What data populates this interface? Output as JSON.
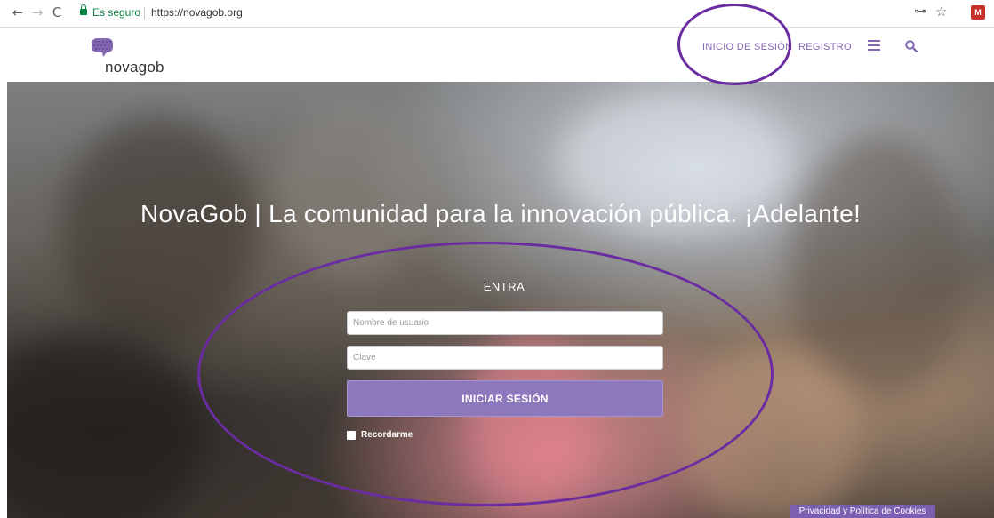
{
  "browser": {
    "back_glyph": "←",
    "forward_glyph": "→",
    "reload_glyph": "C",
    "secure_label": "Es seguro",
    "url": "https://novagob.org",
    "key_glyph": "⊶",
    "star_glyph": "☆",
    "extension_glyph": "M",
    "icons": [
      "back-icon",
      "forward-icon",
      "reload-icon",
      "lock-icon",
      "key-icon",
      "star-icon",
      "extension-icon"
    ]
  },
  "header": {
    "logo_text": "novagob",
    "nav": {
      "login": "INICIO DE SESIÓN",
      "register": "REGISTRO"
    },
    "icons": [
      "menu-icon",
      "search-icon"
    ]
  },
  "hero": {
    "title": "NovaGob | La comunidad para la innovación pública. ¡Adelante!",
    "form": {
      "title": "ENTRA",
      "username_placeholder": "Nombre de usuario",
      "username_value": "",
      "password_placeholder": "Clave",
      "password_value": "",
      "submit_label": "INICIAR SESIÓN",
      "remember_label": "Recordarme",
      "remember_checked": false
    },
    "cookies_label": "Privacidad y Política de Cookies"
  },
  "colors": {
    "accent": "#8367b1",
    "button": "#8d78bd",
    "annotation": "#6a2ca0",
    "secure": "#0b8043"
  }
}
